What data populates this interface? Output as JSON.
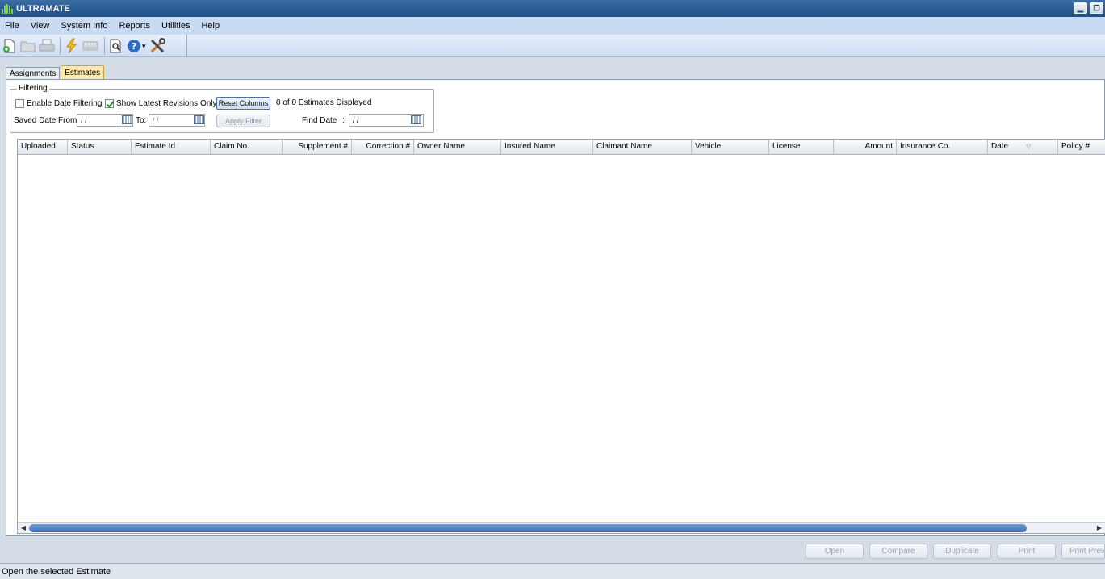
{
  "window": {
    "title": "ULTRAMATE",
    "minimize_glyph": "▁",
    "restore_glyph": "❐"
  },
  "menu": [
    {
      "label": "File"
    },
    {
      "label": "View"
    },
    {
      "label": "System Info"
    },
    {
      "label": "Reports"
    },
    {
      "label": "Utilities"
    },
    {
      "label": "Help"
    }
  ],
  "toolbar": {
    "icons": [
      "new-document-icon",
      "open-folder-icon",
      "print-icon",
      "lightning-icon",
      "ems-icon",
      "preview-icon",
      "help-icon",
      "tools-icon"
    ],
    "ems_label": "EMS",
    "help_dropdown": "▾"
  },
  "tabs": [
    {
      "label": "Assignments",
      "active": false
    },
    {
      "label": "Estimates",
      "active": true
    }
  ],
  "filtering": {
    "legend": "Filtering",
    "enable_date_filtering": {
      "label": "Enable Date Filtering",
      "checked": false
    },
    "show_latest_revisions": {
      "label": "Show Latest Revisions Only",
      "checked": true
    },
    "reset_columns": "Reset Columns",
    "estimates_displayed": "0 of 0 Estimates Displayed",
    "saved_date_from_label": "Saved Date From:",
    "saved_date_from_value": " /  /",
    "to_label": "To:",
    "to_value": " /  /",
    "apply_filter": "Apply Filter",
    "find_date_label": "Find Date",
    "find_date_colon": ":",
    "find_date_value": " /  /"
  },
  "grid": {
    "columns": [
      {
        "label": "Uploaded"
      },
      {
        "label": "Status"
      },
      {
        "label": "Estimate Id"
      },
      {
        "label": "Claim No."
      },
      {
        "label": "Supplement #"
      },
      {
        "label": "Correction #"
      },
      {
        "label": "Owner Name"
      },
      {
        "label": "Insured Name"
      },
      {
        "label": "Claimant Name"
      },
      {
        "label": "Vehicle"
      },
      {
        "label": "License"
      },
      {
        "label": "Amount"
      },
      {
        "label": "Insurance Co."
      },
      {
        "label": "Date"
      },
      {
        "label": "Policy #"
      }
    ],
    "sort_glyph": "▽",
    "scroll_left": "◀",
    "scroll_right": "▶"
  },
  "actions": [
    {
      "label": "Open"
    },
    {
      "label": "Compare"
    },
    {
      "label": "Duplicate"
    },
    {
      "label": "Print"
    },
    {
      "label": "Print Preview"
    }
  ],
  "status": {
    "text": "Open the selected Estimate"
  },
  "colors": {
    "titlebar": "#1f4f86",
    "menubar": "#c9daf3",
    "active_tab": "#fde9a8",
    "scroll_thumb": "#3f71b5"
  }
}
